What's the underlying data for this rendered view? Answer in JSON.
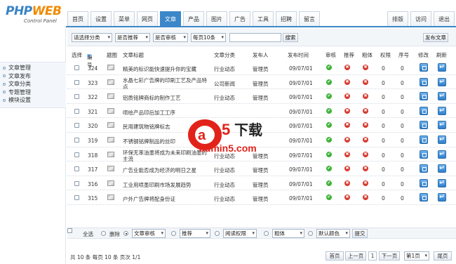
{
  "logo": {
    "brand_a": "PHP",
    "brand_b": "WEB",
    "subtitle": "Control Panel"
  },
  "topnav": {
    "tabs": [
      "首页",
      "设置",
      "菜单",
      "网页",
      "文章",
      "产品",
      "图片",
      "广告",
      "工具",
      "招聘",
      "留言"
    ],
    "active_index": 4,
    "right": [
      "排版",
      "访问",
      "退出"
    ]
  },
  "sidebar": {
    "items": [
      "文章管理",
      "文章发布",
      "文章分类",
      "专题管理",
      "模块设置"
    ]
  },
  "filter": {
    "category": "请选择分类",
    "recommend": "是否推荐",
    "audit": "是否审核",
    "per_page": "每页10条",
    "search_button": "搜索",
    "publish_button": "发布文章"
  },
  "columns": {
    "select": "选择",
    "id": "编号",
    "thumb": "题图",
    "title": "文章标题",
    "category": "文章分类",
    "author": "发布人",
    "time": "发布时间",
    "audit": "审核",
    "recommend": "推荐",
    "bold": "粗体",
    "permission": "权限",
    "order": "序号",
    "edit": "修改",
    "refresh": "刷新"
  },
  "rows": [
    {
      "id": "324",
      "title": "精美的标识能快速提升你的宝藏",
      "title2": "",
      "category": "行业动态",
      "author": "管理员",
      "time": "09/07/01",
      "audit": true,
      "recommend": false,
      "bold": false,
      "permission": "0",
      "order": "0"
    },
    {
      "id": "323",
      "title": "水晶七彩广告牌的印刷工艺及产品特",
      "title2": "点",
      "category": "公司新闻",
      "author": "管理员",
      "time": "09/07/01",
      "audit": true,
      "recommend": false,
      "bold": false,
      "permission": "0",
      "order": "0"
    },
    {
      "id": "322",
      "title": "铝质铭牌商标的制作工艺",
      "title2": "",
      "category": "行业动态",
      "author": "管理员",
      "time": "09/07/01",
      "audit": true,
      "recommend": false,
      "bold": false,
      "permission": "0",
      "order": "0"
    },
    {
      "id": "321",
      "title": "喷绘产品印后加工工序",
      "title2": "",
      "category": "",
      "author": "",
      "time": "09/07/01",
      "audit": true,
      "recommend": false,
      "bold": false,
      "permission": "0",
      "order": "0"
    },
    {
      "id": "320",
      "title": "民用建筑物铭牌标志",
      "title2": "",
      "category": "",
      "author": "",
      "time": "09/07/01",
      "audit": true,
      "recommend": false,
      "bold": false,
      "permission": "0",
      "order": "0"
    },
    {
      "id": "319",
      "title": "不锈钢铭牌制品的丝印",
      "title2": "",
      "category": "",
      "author": "",
      "time": "09/07/01",
      "audit": true,
      "recommend": false,
      "bold": false,
      "permission": "0",
      "order": "0"
    },
    {
      "id": "318",
      "title": "环保无苯油墨将成为未来印刷油墨的",
      "title2": "主流",
      "category": "行业动态",
      "author": "管理员",
      "time": "09/07/01",
      "audit": true,
      "recommend": false,
      "bold": false,
      "permission": "0",
      "order": "0"
    },
    {
      "id": "317",
      "title": "广告业能否成为经济的明日之星",
      "title2": "",
      "category": "行业动态",
      "author": "管理员",
      "time": "09/07/01",
      "audit": true,
      "recommend": false,
      "bold": false,
      "permission": "0",
      "order": "0"
    },
    {
      "id": "316",
      "title": "工业用喷墨印刷市场发展趋势",
      "title2": "",
      "category": "行业动态",
      "author": "管理员",
      "time": "09/07/01",
      "audit": true,
      "recommend": false,
      "bold": false,
      "permission": "0",
      "order": "0"
    },
    {
      "id": "315",
      "title": "户外广告牌将配身份证",
      "title2": "",
      "category": "行业动态",
      "author": "管理员",
      "time": "09/07/01",
      "audit": true,
      "recommend": false,
      "bold": false,
      "permission": "0",
      "order": "0"
    }
  ],
  "bottom": {
    "select_all": "全选",
    "delete": "删除",
    "audit_select": "文章审核",
    "recommend_select": "推荐",
    "permission_select": "阅读权限",
    "bold_select": "粗体",
    "color_select": "默认颜色",
    "submit": "提交"
  },
  "pager": {
    "info": "共 10 条 每页 10 条 页次 1/1",
    "first": "首页",
    "prev": "上一页",
    "current": "1",
    "next": "下一页",
    "page_select": "第1页",
    "last": "尾页"
  },
  "watermark": {
    "big": "a5下载",
    "url": "admin5.com"
  }
}
